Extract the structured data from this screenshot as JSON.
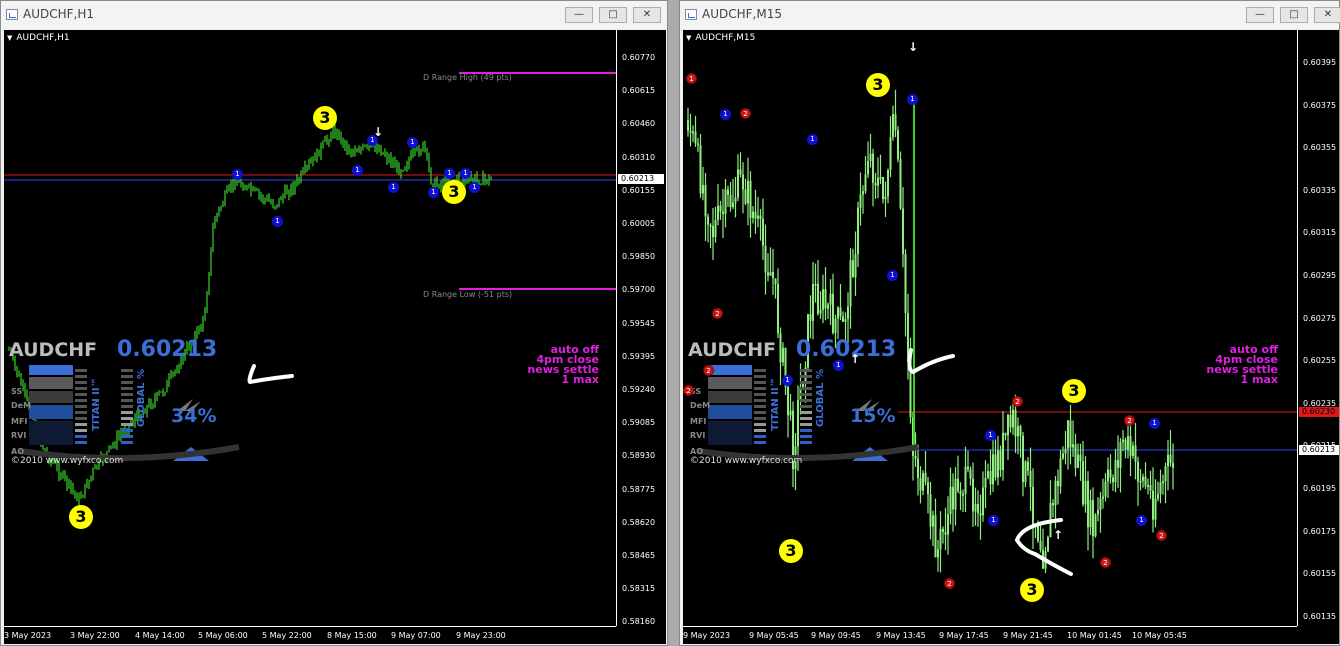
{
  "windows": [
    {
      "title": "AUDCHF,H1",
      "symbol_label": "AUDCHF,H1",
      "price_axis": [
        "0.60770",
        "0.60615",
        "0.60460",
        "0.60310",
        "0.60155",
        "0.60005",
        "0.59850",
        "0.59700",
        "0.59545",
        "0.59395",
        "0.59240",
        "0.59085",
        "0.58930",
        "0.58775",
        "0.58620",
        "0.58465",
        "0.58315",
        "0.58160"
      ],
      "current_price": "0.60213",
      "time_axis": [
        "3 May 2023",
        "3 May 22:00",
        "4 May 14:00",
        "5 May 06:00",
        "5 May 22:00",
        "8 May 15:00",
        "9 May 07:00",
        "9 May 23:00"
      ],
      "range_high_label": "D Range High (49 pts)",
      "range_low_label": "D Range Low (-51 pts)",
      "widget": {
        "symbol": "AUDCHF",
        "price": "0.60213",
        "percent": "34%",
        "titan": "TITAN II™",
        "global": "GLOBAL %",
        "copyright": "©2010 www.wyfxco.com",
        "side_labels": [
          "SS",
          "DeM",
          "MFI",
          "RVI",
          "AO"
        ]
      },
      "auto_box": [
        "auto off",
        "4pm close",
        "news settle",
        "1 max"
      ],
      "badges": [
        "3",
        "3",
        "3"
      ],
      "dot_labels": [
        "1",
        "1",
        "1",
        "1",
        "1",
        "1",
        "1",
        "1",
        "1",
        "1"
      ]
    },
    {
      "title": "AUDCHF,M15",
      "symbol_label": "AUDCHF,M15",
      "price_axis": [
        "0.60395",
        "0.60375",
        "0.60355",
        "0.60335",
        "0.60315",
        "0.60295",
        "0.60275",
        "0.60255",
        "0.60235",
        "0.60215",
        "0.60195",
        "0.60175",
        "0.60155",
        "0.60135"
      ],
      "current_price": "0.60213",
      "red_line_price": "0.60230",
      "time_axis": [
        "9 May 2023",
        "9 May 05:45",
        "9 May 09:45",
        "9 May 13:45",
        "9 May 17:45",
        "9 May 21:45",
        "10 May 01:45",
        "10 May 05:45"
      ],
      "widget": {
        "symbol": "AUDCHF",
        "price": "0.60213",
        "percent": "15%",
        "titan": "TITAN II™",
        "global": "GLOBAL %",
        "copyright": "©2010 www.wyfxco.com",
        "side_labels": [
          "SS",
          "DeM",
          "MFI",
          "RVI",
          "AO"
        ]
      },
      "auto_box": [
        "auto off",
        "4pm close",
        "news settle",
        "1 max"
      ],
      "badges": [
        "3",
        "3",
        "3",
        "3"
      ],
      "dot_labels": [
        "1",
        "2",
        "1",
        "1",
        "1",
        "1",
        "2",
        "1",
        "1",
        "2",
        "1",
        "2",
        "2",
        "1",
        "2",
        "2",
        "1",
        "2",
        "1",
        "2"
      ]
    }
  ],
  "colors": {
    "candle_green": "#39d129",
    "candle_light": "#90ee80",
    "magenta": "#e020e0",
    "blue_line": "#2e45ff",
    "red_line": "#e01818",
    "accent_blue": "#3b6fd6",
    "badge_yellow": "#ffff00"
  }
}
